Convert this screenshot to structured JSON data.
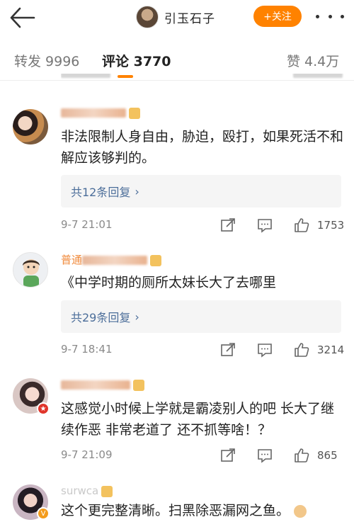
{
  "header": {
    "title": "引玉石子",
    "follow_label": "+关注"
  },
  "tabs": {
    "repost": "转发 9996",
    "comments": "评论 3770",
    "likes": "赞 4.4万"
  },
  "colors": {
    "accent": "#ff8200",
    "link": "#4c6e9a",
    "username": "#f08a3c"
  },
  "comments": [
    {
      "text": "非法限制人身自由，胁迫，殴打，如果死活不和解应该够判的。",
      "replies": "共12条回复",
      "time": "9-7 21:01",
      "likes": "1753"
    },
    {
      "username_prefix": "普通",
      "text": "《中学时期的厕所太妹长大了去哪里",
      "replies": "共29条回复",
      "time": "9-7 18:41",
      "likes": "3214"
    },
    {
      "text": "这感觉小时候上学就是霸凌别人的吧 长大了继续作恶 非常老道了 还不抓等啥！？",
      "time": "9-7 21:09",
      "likes": "865"
    },
    {
      "username_prefix": "surwca",
      "text": "这个更完整清晰。扫黑除恶漏网之鱼。"
    }
  ],
  "icons": {
    "back": "arrow-left-icon",
    "more": "more-dots-icon",
    "share": "share-icon",
    "comment": "comment-icon",
    "like": "thumbs-up-icon"
  }
}
